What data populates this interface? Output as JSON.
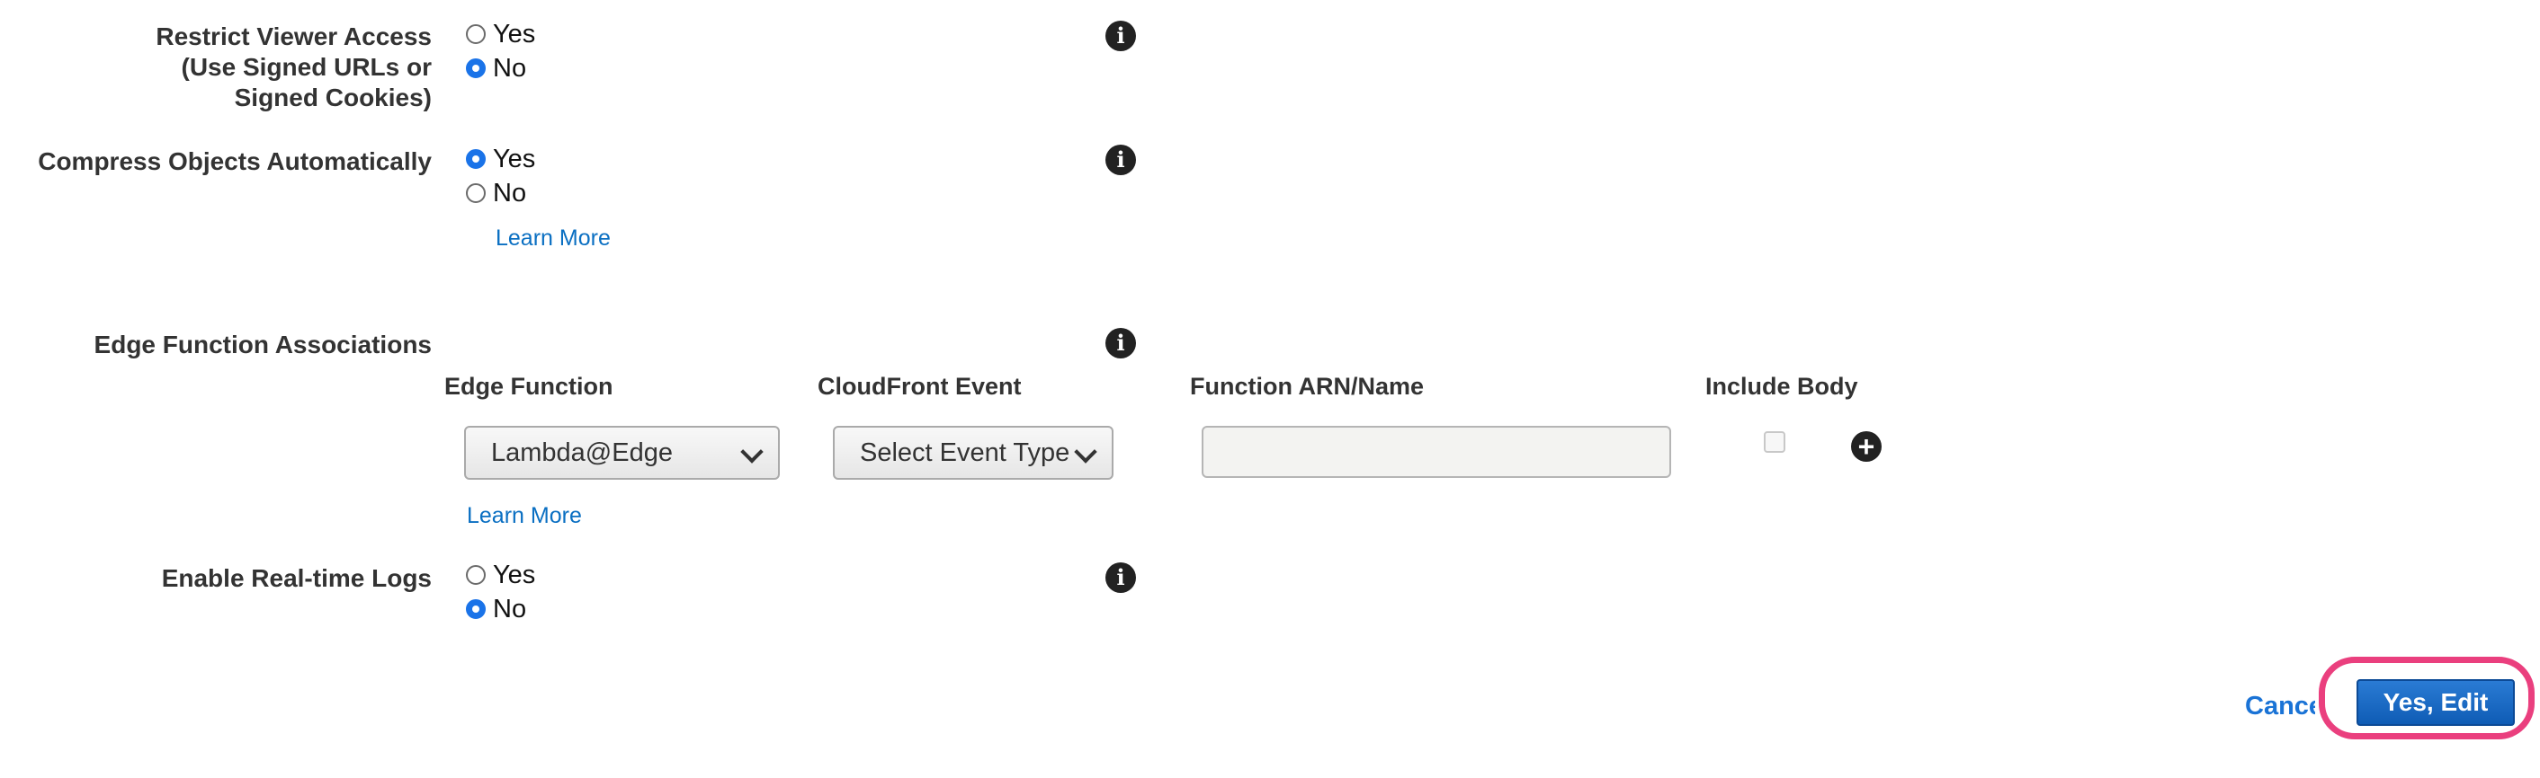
{
  "restrict_viewer": {
    "label_lines": [
      "Restrict Viewer Access",
      "(Use Signed URLs or",
      "Signed Cookies)"
    ],
    "options": [
      {
        "label": "Yes",
        "checked": false
      },
      {
        "label": "No",
        "checked": true
      }
    ]
  },
  "compress": {
    "label": "Compress Objects Automatically",
    "options": [
      {
        "label": "Yes",
        "checked": true
      },
      {
        "label": "No",
        "checked": false
      }
    ],
    "learn_more": "Learn More"
  },
  "edge_functions": {
    "label": "Edge Function Associations",
    "columns": [
      "Edge Function",
      "CloudFront Event",
      "Function ARN/Name",
      "Include Body"
    ],
    "edge_function_value": "Lambda@Edge",
    "event_value": "Select Event Type",
    "arn_value": "",
    "include_body": false,
    "learn_more": "Learn More"
  },
  "realtime_logs": {
    "label": "Enable Real-time Logs",
    "options": [
      {
        "label": "Yes",
        "checked": false
      },
      {
        "label": "No",
        "checked": true
      }
    ]
  },
  "icons": {
    "info": "info-icon",
    "add": "plus-circle-icon"
  },
  "footer": {
    "cancel_label": "Cancel",
    "submit_label": "Yes, Edit"
  },
  "colors": {
    "link": "#0a6fc2",
    "primary_button": "#1a6dcb",
    "highlight": "#ea3f7e",
    "radio_checked": "#1a73e8"
  }
}
